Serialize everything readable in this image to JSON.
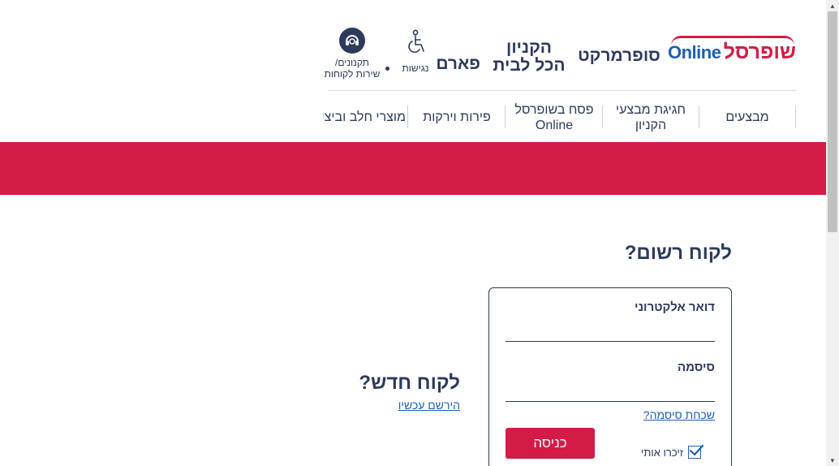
{
  "header": {
    "logo": {
      "hebrew": "שופרסל",
      "latin": "Online"
    },
    "links": {
      "supermarket": "סופרמרקט",
      "kanyon_line1": "הקניון",
      "kanyon_line2": "הכל לבית",
      "pharm": "פארם"
    },
    "accessibility_label": "נגישות",
    "support_line1": "תקנונים/",
    "support_line2": "שירות לקוחות"
  },
  "nav": {
    "items": [
      {
        "label": "מבצעים"
      },
      {
        "label": "חגיגת מבצעי הקניון"
      },
      {
        "label": "פסח בשופרסל Online"
      },
      {
        "label": "פירות וירקות"
      },
      {
        "label": "מוצרי חלב וביצי"
      }
    ]
  },
  "colors": {
    "brand_red": "#d31b48",
    "navy": "#2c3a5c",
    "link_blue": "#1e5fb4"
  },
  "login": {
    "title": "לקוח רשום?",
    "email_label": "דואר אלקטרוני",
    "email_value": "",
    "password_label": "סיסמה",
    "password_value": "",
    "forgot_link": "שכחת סיסמה?",
    "submit_label": "כניסה",
    "remember_label": "זיכרו אותי",
    "remember_checked": true
  },
  "new_customer": {
    "title": "לקוח חדש?",
    "register_link": "הירשם עכשיו"
  }
}
